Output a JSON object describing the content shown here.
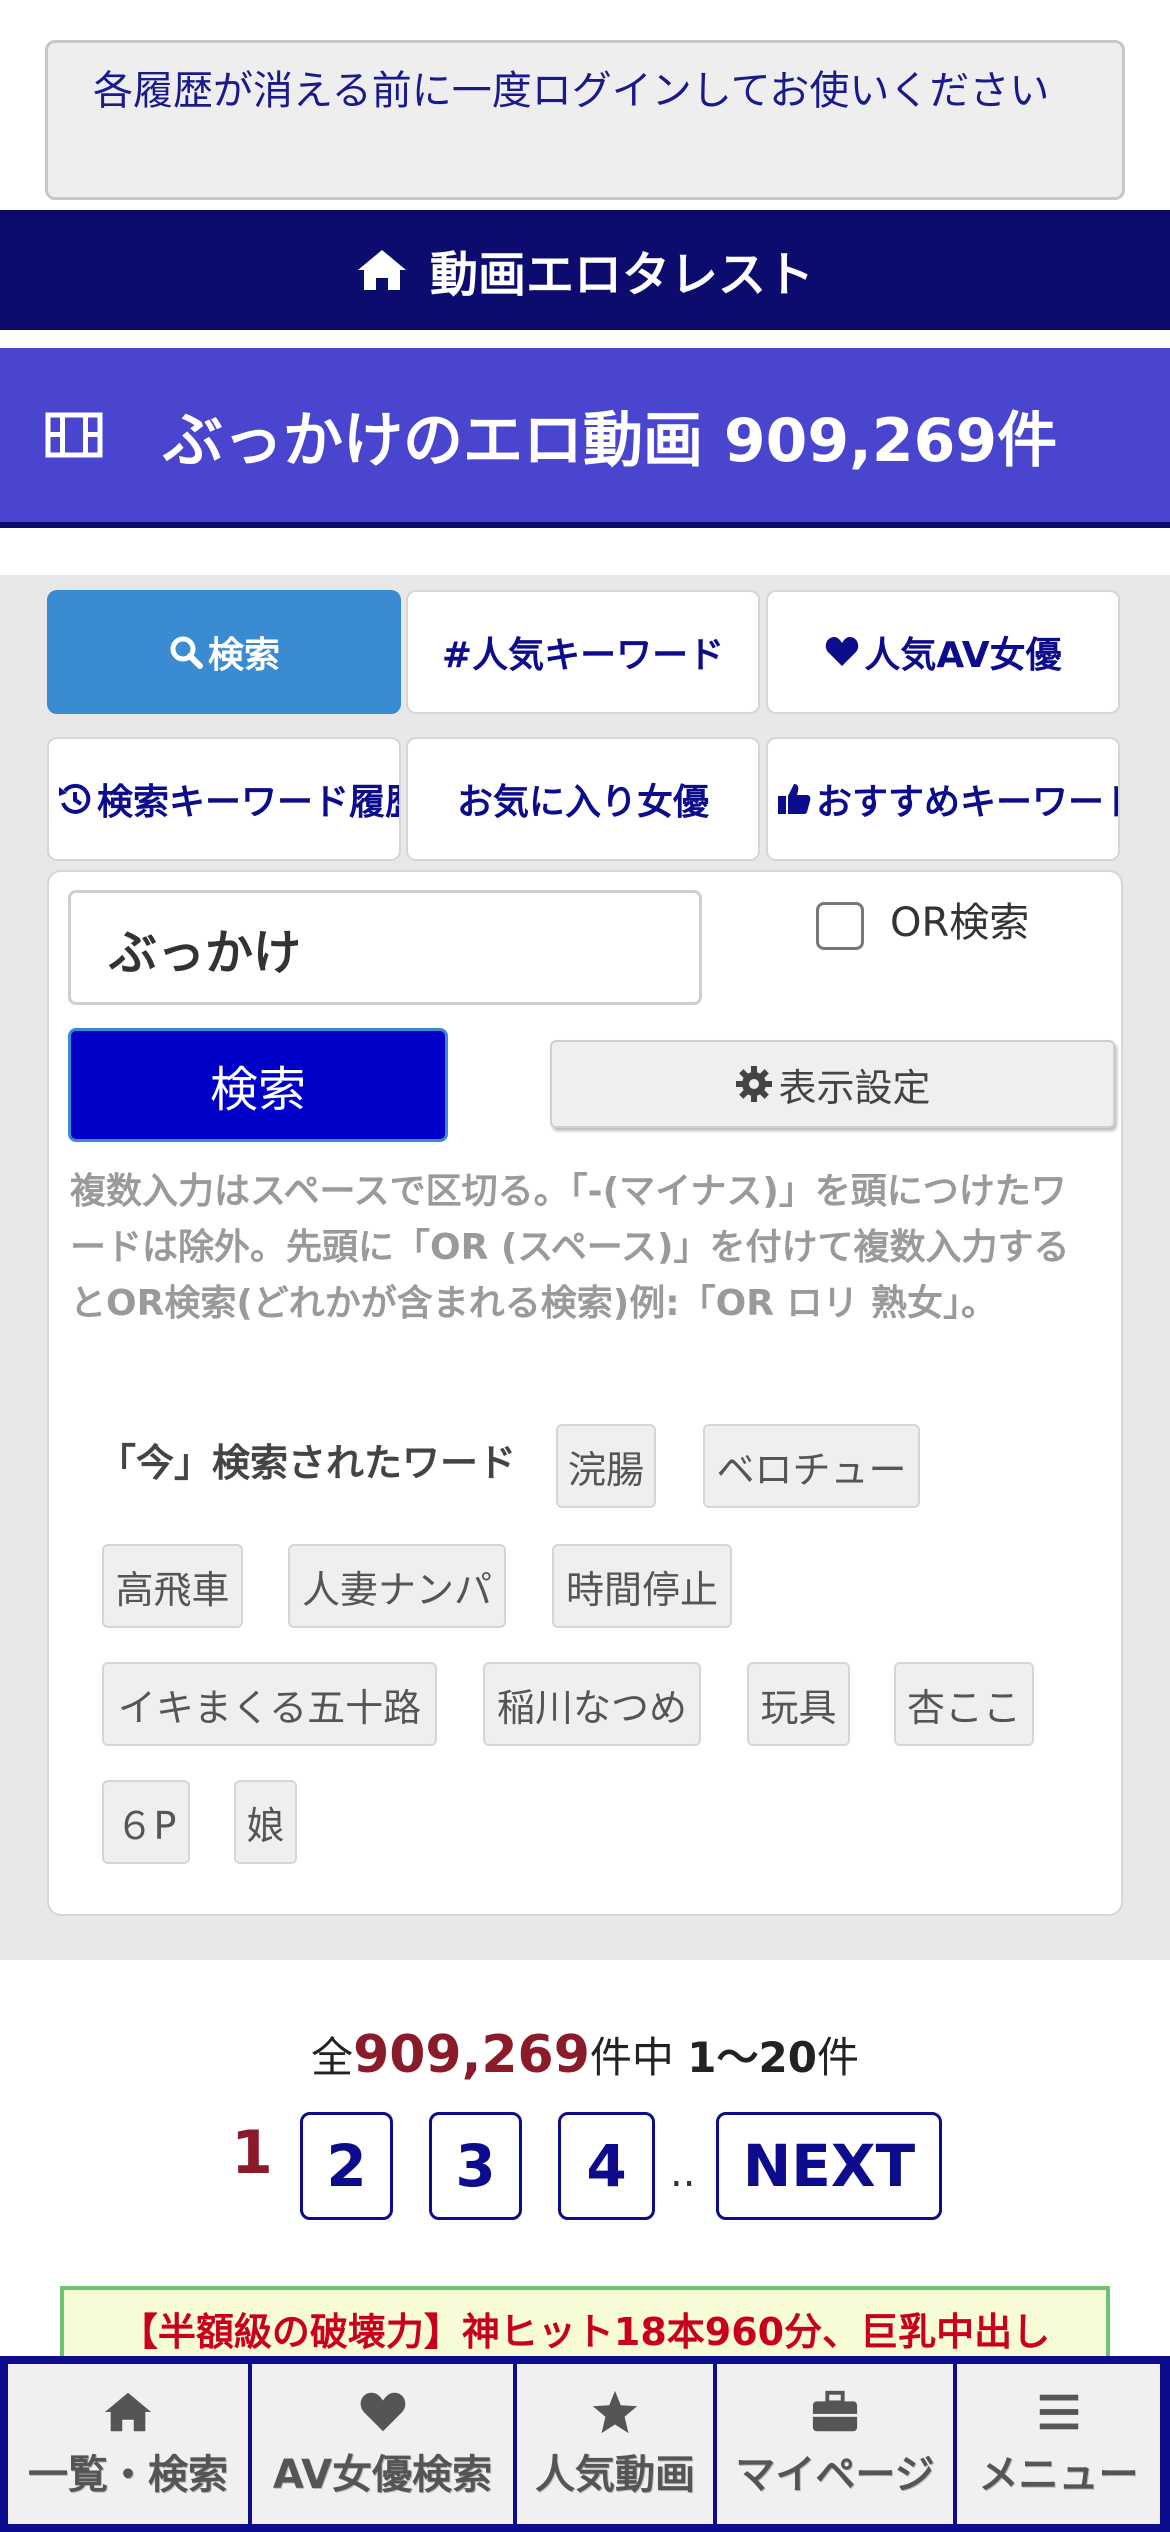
{
  "notice": {
    "text": "各履歴が消える前に一度ログインしてお使いください"
  },
  "site": {
    "name": "動画エロタレスト"
  },
  "page_title": {
    "text": "ぶっかけのエロ動画 909,269件"
  },
  "tabs": [
    {
      "label": "検索",
      "icon": "search-icon"
    },
    {
      "label": "#人気キーワード"
    },
    {
      "label": "人気AV女優",
      "icon": "heart-icon"
    },
    {
      "label": "検索キーワード履歴",
      "icon": "history-icon"
    },
    {
      "label": "お気に入り女優"
    },
    {
      "label": "おすすめキーワード",
      "icon": "thumbs-up-icon"
    }
  ],
  "search": {
    "value": "ぶっかけ",
    "or_label": "OR検索",
    "button_label": "検索",
    "settings_label": "表示設定",
    "help_text": "複数入力はスペースで区切る。「-(マイナス)」を頭につけたワードは除外。先頭に「OR (スペース)」を付けて複数入力するとOR検索(どれかが含まれる検索)例:「OR ロリ 熟女」。"
  },
  "trending": {
    "label": "「今」検索されたワード",
    "words": [
      "浣腸",
      "ベロチュー",
      "高飛車",
      "人妻ナンパ",
      "時間停止",
      "イキまくる五十路",
      "稲川なつめ",
      "玩具",
      "杏ここ",
      "６P",
      "娘"
    ]
  },
  "results": {
    "prefix": "全",
    "total": "909,269",
    "middle": "件中 ",
    "range": "1〜20",
    "suffix": "件"
  },
  "pagination": {
    "current": "1",
    "pages": [
      "2",
      "3",
      "4"
    ],
    "ellipsis": "..",
    "next_label": "NEXT"
  },
  "promo": {
    "text": "【半額級の破壊力】神ヒット18本960分、巨乳中出し"
  },
  "bottom_nav": [
    {
      "label": "一覧・検索",
      "icon": "home-icon"
    },
    {
      "label": "AV女優検索",
      "icon": "heart-icon"
    },
    {
      "label": "人気動画",
      "icon": "star-icon"
    },
    {
      "label": "マイページ",
      "icon": "briefcase-icon"
    },
    {
      "label": "メニュー",
      "icon": "menu-icon"
    }
  ],
  "colors": {
    "site_bar": "#0c0c6e",
    "title_bar": "#4a45cf",
    "active_tab": "#3a8bd2",
    "search_button": "#0000c8",
    "count_accent": "#8b1a2a",
    "promo_text": "#c8001e"
  }
}
